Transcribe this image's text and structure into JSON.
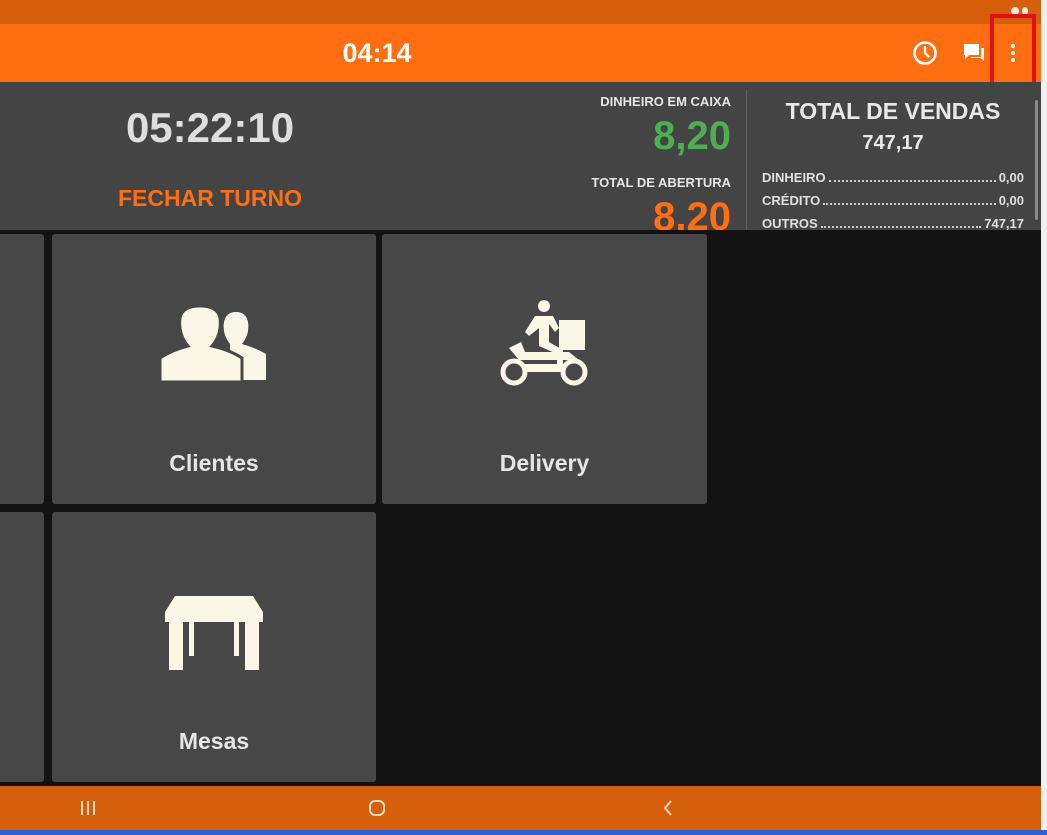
{
  "app_bar": {
    "title": "04:14",
    "clock_icon": "clock-icon",
    "chat_icon": "chat-icon",
    "menu_icon": "more-vert-icon"
  },
  "shift": {
    "timer": "05:22:10",
    "close_label": "FECHAR TURNO"
  },
  "cash": {
    "in_drawer_label": "DINHEIRO EM CAIXA",
    "in_drawer_value": "8,20",
    "opening_label": "TOTAL DE ABERTURA",
    "opening_value": "8,20"
  },
  "sales": {
    "title": "TOTAL DE VENDAS",
    "total": "747,17",
    "breakdown": [
      {
        "label": "DINHEIRO",
        "value": "0,00"
      },
      {
        "label": "CRÉDITO",
        "value": "0,00"
      },
      {
        "label": "OUTROS",
        "value": "747,17"
      }
    ]
  },
  "tiles": [
    {
      "label": "Clientes",
      "icon": "people-icon"
    },
    {
      "label": "Delivery",
      "icon": "delivery-scooter-icon"
    },
    {
      "label": "Mesas",
      "icon": "table-icon"
    }
  ],
  "nav": {
    "recents_icon": "recents-icon",
    "home_icon": "home-icon",
    "back_icon": "back-icon"
  },
  "colors": {
    "accent": "#ff6f12",
    "positive": "#4caf50",
    "panel": "#444444",
    "background": "#131313"
  }
}
